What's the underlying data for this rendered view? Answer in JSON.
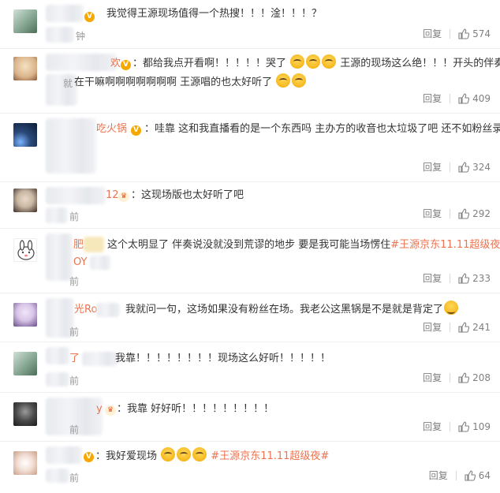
{
  "comments": [
    {
      "nickname_tail": "",
      "badge": "vip",
      "text": "我觉得王源现场值得一个热搜！！！淦！！！？",
      "time_fragment": "钟",
      "reply_label": "回复",
      "likes": "574",
      "avatar_colors": [
        "#a9c7b5",
        "#5b7f68"
      ]
    },
    {
      "nickname_tail": "欢",
      "badge": "vip",
      "text_line1": "：都给我点开看啊！！！！！哭了",
      "text_line1b": "王源的现场这么绝！！！开头的伴奏真的",
      "text_line2": "在干嘛啊啊啊啊啊啊啊 王源唱的也太好听了",
      "time_fragment": "就",
      "reply_label": "回复",
      "likes": "409",
      "avatar_colors": [
        "#f1d3a8",
        "#8a5a3a"
      ]
    },
    {
      "nickname_tail": "吃火锅",
      "badge": "vip",
      "text": "：哇靠 这和我直播看的是一个东西吗 主办方的收音也太垃圾了吧 还不如粉丝录的好",
      "reply_label": "回复",
      "likes": "324",
      "avatar_colors": [
        "#2b4a7a",
        "#0d1b33"
      ]
    },
    {
      "nickname_tail": "12",
      "badge": "crown",
      "text": "：这现场版也太好听了吧",
      "time_fragment": "前",
      "reply_label": "回复",
      "likes": "292",
      "avatar_colors": [
        "#c9b7a3",
        "#3a2b25"
      ]
    },
    {
      "nickname_tail": "肥",
      "badge": "vip",
      "text": "这个太明显了 伴奏说没就没到荒谬的地步 要是我可能当场愣住",
      "hashtag": "#王源京东11.11超级夜#",
      "name_line2": "OY",
      "time_fragment": "前",
      "reply_label": "回复",
      "likes": "233",
      "avatar_colors": [
        "#ffffff",
        "#333333"
      ]
    },
    {
      "nickname_tail": "光Ro",
      "badge": "",
      "text": "我就问一句，这场如果没有粉丝在场。我老公这黑锅是不是就是背定了",
      "time_fragment": "前",
      "reply_label": "回复",
      "likes": "241",
      "avatar_colors": [
        "#d8c4e8",
        "#6b4f8a"
      ]
    },
    {
      "nickname_tail": "了",
      "badge": "",
      "text": "我靠！！！！！！！！现场这么好听！！！！！",
      "time_fragment": "前",
      "reply_label": "回复",
      "likes": "208",
      "avatar_colors": [
        "#a9c7b5",
        "#5b7f68"
      ]
    },
    {
      "nickname_tail": "y",
      "badge": "crown",
      "text": "：我靠 好好听！！！！！！！！！",
      "time_fragment": "前",
      "reply_label": "回复",
      "likes": "109",
      "avatar_colors": [
        "#6b6b6b",
        "#1c1c1c"
      ]
    },
    {
      "nickname_tail": "",
      "badge": "vip",
      "text": "：我好爱现场",
      "hashtag": "#王源京东11.11超级夜#",
      "time_fragment": "前",
      "reply_label": "回复",
      "likes": "64",
      "avatar_colors": [
        "#f3e0d6",
        "#c9a08a"
      ]
    }
  ],
  "colors": {
    "link": "#eb7350",
    "muted": "#808080",
    "vip": "#f7a800"
  }
}
